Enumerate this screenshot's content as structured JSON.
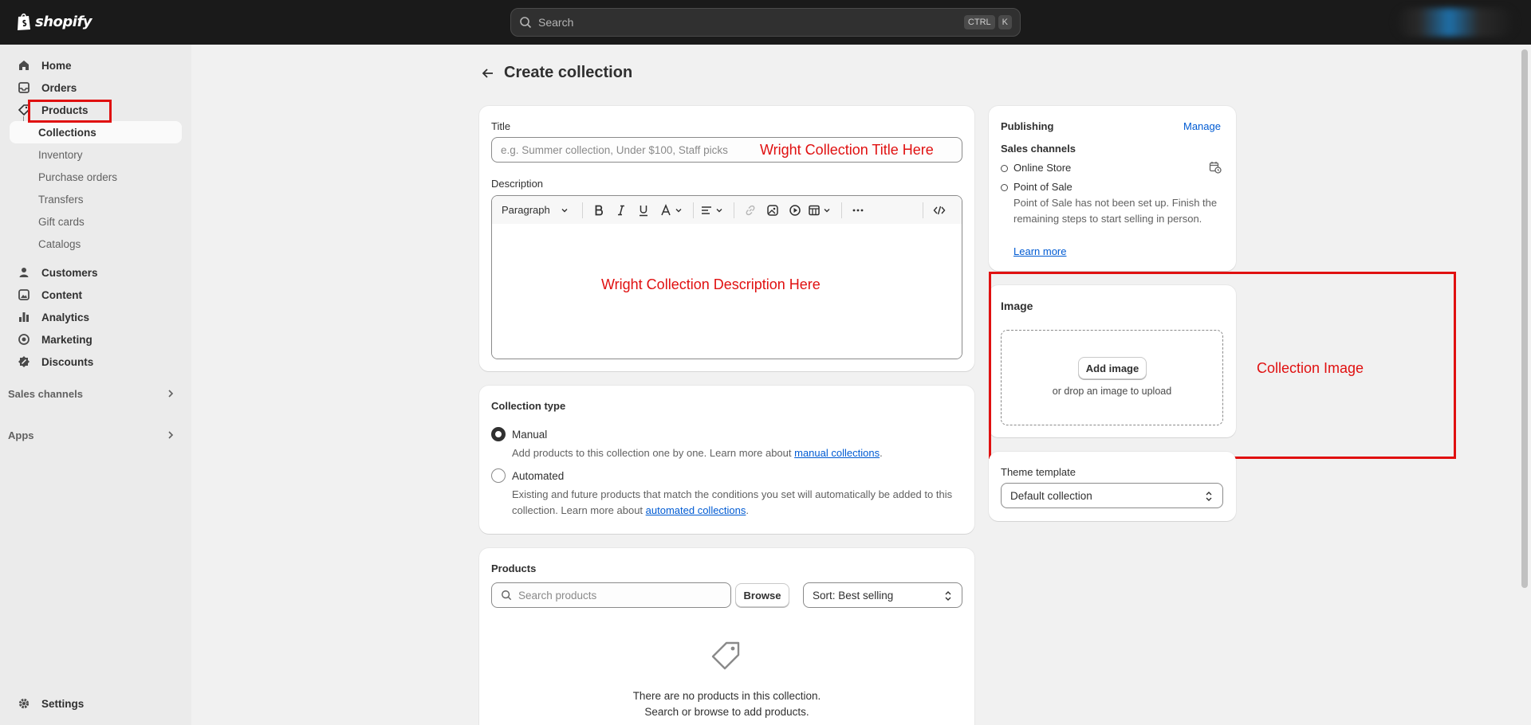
{
  "topbar": {
    "logo_text": "shopify",
    "search_placeholder": "Search",
    "shortcut_keys": [
      "CTRL",
      "K"
    ]
  },
  "sidebar": {
    "items": [
      {
        "label": "Home",
        "icon": "home-icon"
      },
      {
        "label": "Orders",
        "icon": "inbox-icon"
      },
      {
        "label": "Products",
        "icon": "tag-icon"
      },
      {
        "label": "Collections",
        "active": true
      },
      {
        "label": "Inventory"
      },
      {
        "label": "Purchase orders"
      },
      {
        "label": "Transfers"
      },
      {
        "label": "Gift cards"
      },
      {
        "label": "Catalogs"
      },
      {
        "label": "Customers",
        "icon": "person-icon"
      },
      {
        "label": "Content",
        "icon": "content-icon"
      },
      {
        "label": "Analytics",
        "icon": "bar-chart-icon"
      },
      {
        "label": "Marketing",
        "icon": "target-icon"
      },
      {
        "label": "Discounts",
        "icon": "discount-icon"
      }
    ],
    "sections": {
      "sales_channels": "Sales channels",
      "apps": "Apps"
    },
    "settings_label": "Settings"
  },
  "page": {
    "title": "Create collection"
  },
  "title_card": {
    "title_label": "Title",
    "title_placeholder": "e.g. Summer collection, Under $100, Staff picks",
    "title_annotation": "Wright Collection Title Here",
    "description_label": "Description",
    "toolbar_format": "Paragraph",
    "description_annotation": "Wright Collection Description Here"
  },
  "collection_type": {
    "heading": "Collection type",
    "manual_label": "Manual",
    "manual_help": "Add products to this collection one by one. Learn more about ",
    "manual_link": "manual collections",
    "automated_label": "Automated",
    "automated_help": "Existing and future products that match the conditions you set will automatically be added to this collection. Learn more about ",
    "automated_link": "automated collections",
    "period": "."
  },
  "products_card": {
    "heading": "Products",
    "search_placeholder": "Search products",
    "browse_label": "Browse",
    "sort_label": "Sort: Best selling",
    "empty_line1": "There are no products in this collection.",
    "empty_line2": "Search or browse to add products."
  },
  "publishing": {
    "heading": "Publishing",
    "manage_label": "Manage",
    "sales_channels_label": "Sales channels",
    "online_store": "Online Store",
    "pos": "Point of Sale",
    "pos_note": "Point of Sale has not been set up. Finish the remaining steps to start selling in person.",
    "learn_more": "Learn more"
  },
  "image_card": {
    "heading": "Image",
    "add_image_label": "Add image",
    "drop_text": "or drop an image to upload",
    "annotation": "Collection Image"
  },
  "theme": {
    "label": "Theme template",
    "value": "Default collection"
  },
  "colors": {
    "annotation_red": "#e01010",
    "link_blue": "#005bd3",
    "topbar_bg": "#1a1a1a"
  }
}
